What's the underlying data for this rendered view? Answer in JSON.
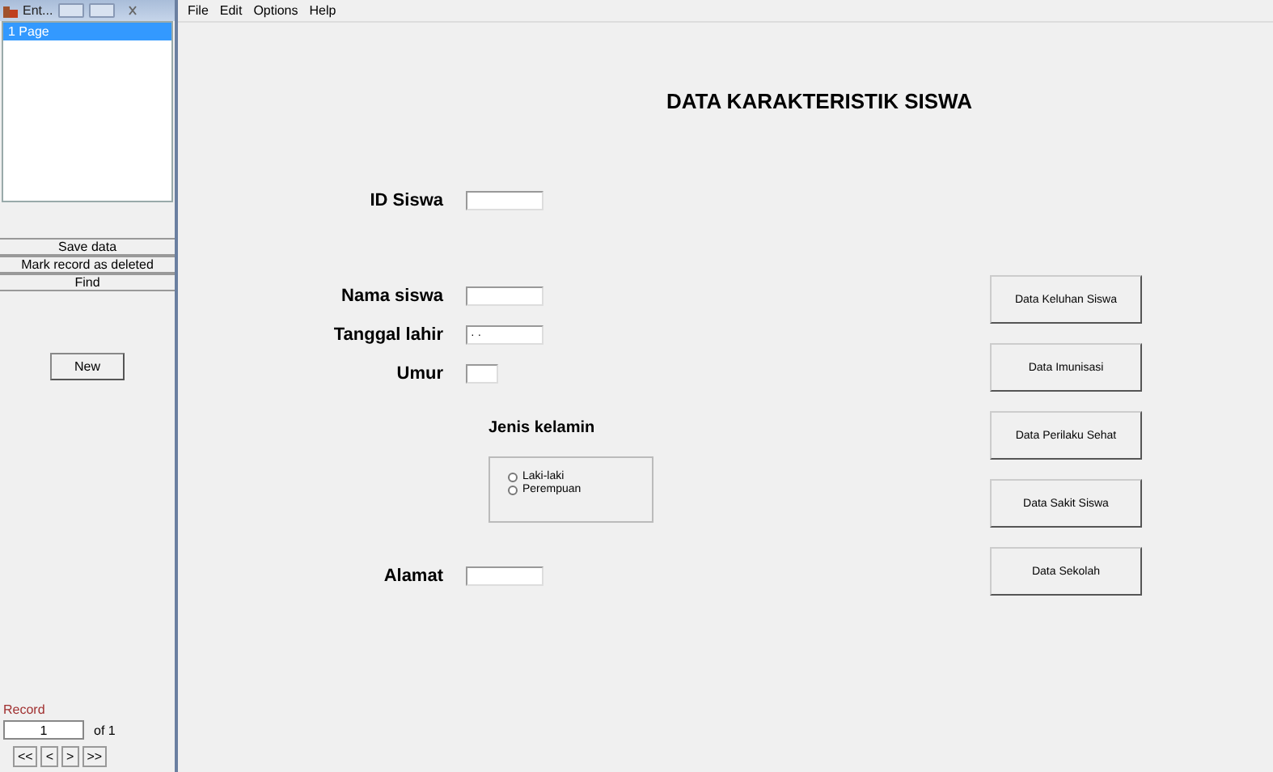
{
  "side_window": {
    "title": "Ent...",
    "list": [
      {
        "label": "1   Page",
        "selected": true
      }
    ],
    "actions": [
      "Save data",
      "Mark record as deleted",
      "Find"
    ],
    "new_button": "New",
    "record": {
      "label": "Record",
      "value": "1",
      "of": "of 1",
      "nav": [
        "<<",
        "<",
        ">",
        ">>"
      ]
    }
  },
  "menu": [
    "File",
    "Edit",
    "Options",
    "Help"
  ],
  "form": {
    "title": "DATA KARAKTERISTIK SISWA",
    "fields": [
      {
        "label": "ID Siswa",
        "kind": "text"
      },
      {
        "label": "Nama siswa",
        "kind": "text"
      },
      {
        "label": "Tanggal lahir",
        "kind": "date",
        "value": "· ·"
      },
      {
        "label": "Umur",
        "kind": "short"
      }
    ],
    "gender": {
      "label": "Jenis kelamin",
      "options": [
        {
          "label": "Laki-laki",
          "selected": false
        },
        {
          "label": "Perempuan",
          "selected": false
        }
      ]
    },
    "address": {
      "label": "Alamat"
    },
    "buttons": [
      "Data Keluhan Siswa",
      "Data Imunisasi",
      "Data Perilaku Sehat",
      "Data Sakit Siswa",
      "Data Sekolah"
    ]
  }
}
